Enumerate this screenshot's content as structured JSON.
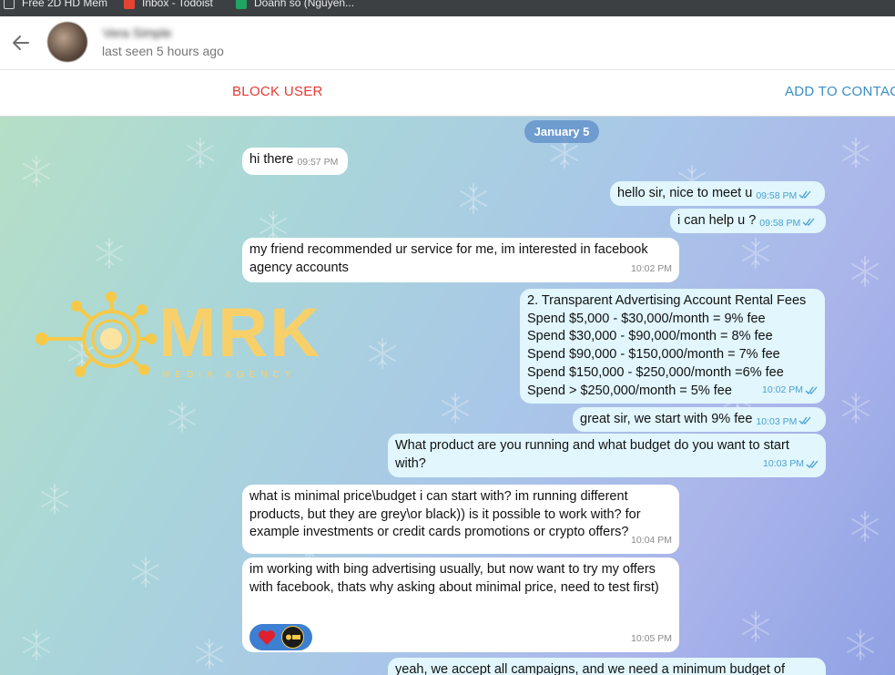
{
  "bookmarks": [
    {
      "label": "Free 2D HD Mem",
      "icon": "bookmark-page-icon"
    },
    {
      "label": "Inbox - Todoist",
      "icon": "todoist-icon"
    },
    {
      "label": "Doanh số (Nguyễn...",
      "icon": "sheets-icon"
    }
  ],
  "header": {
    "contact_name": "Vera Simple",
    "last_seen": "last seen 5 hours ago"
  },
  "actions": {
    "block_user": "BLOCK USER",
    "add_to_contact": "ADD TO CONTAC"
  },
  "date_label": "January 5",
  "logo": {
    "text": "MRK",
    "subtitle": "MEDIA AGENCY"
  },
  "messages": [
    {
      "dir": "in",
      "text": "hi there",
      "time": "09:57 PM"
    },
    {
      "dir": "out",
      "text": "hello sir, nice to meet u",
      "time": "09:58 PM",
      "read": true
    },
    {
      "dir": "out",
      "text": "i can help u ?",
      "time": "09:58 PM",
      "read": true
    },
    {
      "dir": "in",
      "text": "my friend recommended ur service for me, im interested in facebook agency accounts",
      "time": "10:02 PM"
    },
    {
      "dir": "out",
      "lines": [
        "2. Transparent Advertising Account Rental Fees",
        "Spend $5,000 - $30,000/month = 9% fee",
        "Spend $30,000 - $90,000/month = 8% fee",
        "Spend $90,000 - $150,000/month = 7% fee",
        "Spend $150,000 - $250,000/month =6% fee",
        "Spend > $250,000/month = 5% fee"
      ],
      "time": "10:02 PM",
      "read": true
    },
    {
      "dir": "out",
      "text": "great sir, we start with 9% fee",
      "time": "10:03 PM",
      "read": true
    },
    {
      "dir": "out",
      "text": "What product are you running and what budget do you want to start with?",
      "time": "10:03 PM",
      "read": true
    },
    {
      "dir": "in",
      "text": "what is minimal price\\budget i can start with? im running different products, but they are grey\\or black)) is it possible to work with? for example investments or credit cards promotions or crypto offers?",
      "time": "10:04 PM"
    },
    {
      "dir": "in",
      "text": "im working with bing advertising usually, but now want to try my offers with facebook, thats why asking about minimal price, need to test first)",
      "time": "10:05 PM",
      "reactions": [
        "heart-reaction-icon",
        "mrk-avatar-icon"
      ]
    },
    {
      "dir": "out",
      "text": "yeah, we accept all campaigns, and we need a minimum budget of"
    }
  ],
  "colors": {
    "block": "#e53935",
    "add_contact": "#3a8dc4",
    "outgoing_bubble": "#e1f6fd",
    "incoming_bubble": "#ffffff",
    "date_pill": "#5c8cc8",
    "reaction_pill": "#3d7fd0"
  }
}
